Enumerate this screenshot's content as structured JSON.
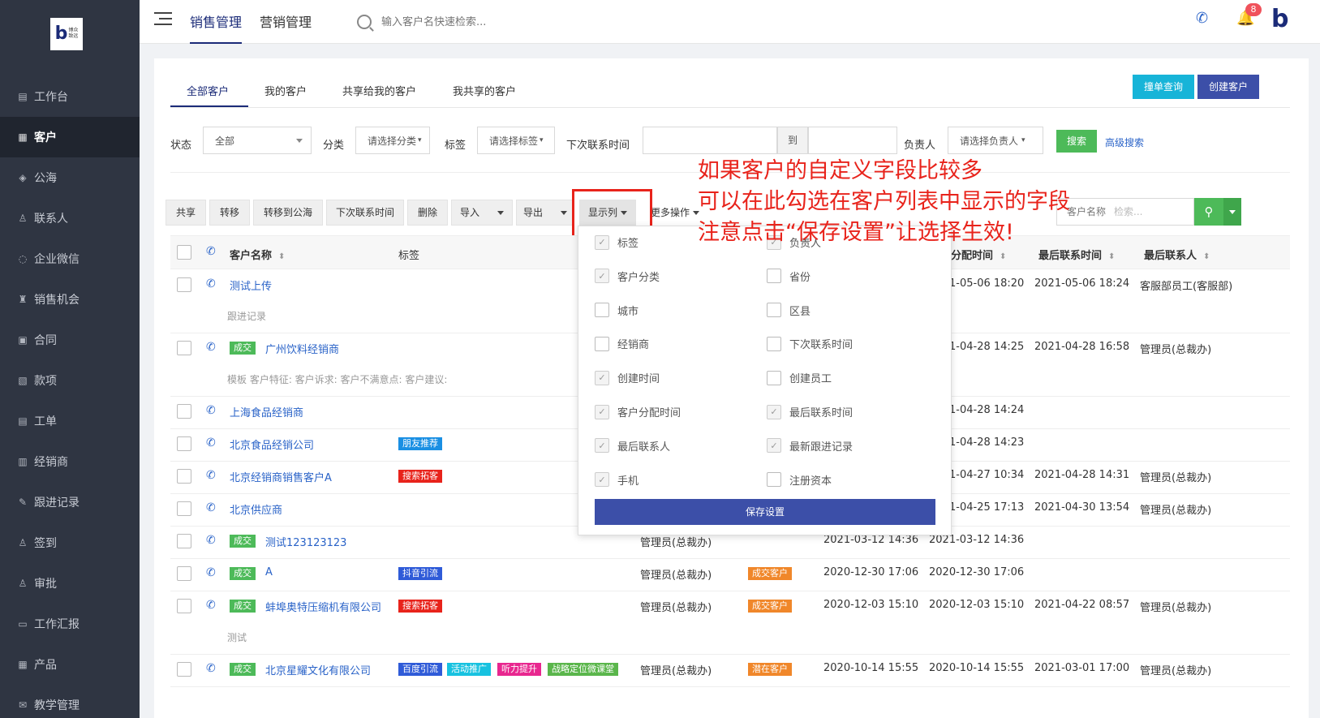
{
  "sidebar": {
    "logo": {
      "letter": "b",
      "text": "博众\n致远"
    },
    "items": [
      {
        "icon": "dashboard-icon",
        "glyph": "▤",
        "label": "工作台",
        "active": false
      },
      {
        "icon": "customer-icon",
        "glyph": "▦",
        "label": "客户",
        "active": true
      },
      {
        "icon": "public-pool-icon",
        "glyph": "◈",
        "label": "公海",
        "active": false
      },
      {
        "icon": "contact-icon",
        "glyph": "♙",
        "label": "联系人",
        "active": false
      },
      {
        "icon": "wechat-icon",
        "glyph": "◌",
        "label": "企业微信",
        "active": false
      },
      {
        "icon": "opportunity-icon",
        "glyph": "♜",
        "label": "销售机会",
        "active": false
      },
      {
        "icon": "contract-icon",
        "glyph": "▣",
        "label": "合同",
        "active": false
      },
      {
        "icon": "payment-icon",
        "glyph": "▧",
        "label": "款项",
        "active": false
      },
      {
        "icon": "ticket-icon",
        "glyph": "▤",
        "label": "工单",
        "active": false
      },
      {
        "icon": "dealer-icon",
        "glyph": "▥",
        "label": "经销商",
        "active": false
      },
      {
        "icon": "followup-icon",
        "glyph": "✎",
        "label": "跟进记录",
        "active": false
      },
      {
        "icon": "checkin-icon",
        "glyph": "♙",
        "label": "签到",
        "active": false
      },
      {
        "icon": "approval-icon",
        "glyph": "♙",
        "label": "审批",
        "active": false
      },
      {
        "icon": "report-icon",
        "glyph": "▭",
        "label": "工作汇报",
        "active": false
      },
      {
        "icon": "product-icon",
        "glyph": "▦",
        "label": "产品",
        "active": false
      },
      {
        "icon": "teaching-icon",
        "glyph": "✉",
        "label": "教学管理",
        "active": false
      }
    ]
  },
  "topbar": {
    "tabs": [
      {
        "label": "销售管理",
        "active": true
      },
      {
        "label": "营销管理",
        "active": false
      }
    ],
    "search_placeholder": "输入客户名快速检索...",
    "bell_count": "8",
    "brand_letter": "b"
  },
  "subtabs": [
    {
      "label": "全部客户",
      "active": true
    },
    {
      "label": "我的客户",
      "active": false
    },
    {
      "label": "共享给我的客户",
      "active": false
    },
    {
      "label": "我共享的客户",
      "active": false
    }
  ],
  "actions": {
    "check_duplicate": "撞单查询",
    "create_customer": "创建客户"
  },
  "filters": {
    "status_label": "状态",
    "status_value": "全部",
    "category_label": "分类",
    "category_value": "请选择分类",
    "tag_label": "标签",
    "tag_value": "请选择标签",
    "next_contact_label": "下次联系时间",
    "to_label": "到",
    "owner_label": "负责人",
    "owner_value": "请选择负责人",
    "search_btn": "搜索",
    "advanced": "高级搜索"
  },
  "toolbar": {
    "share": "共享",
    "transfer": "转移",
    "to_pool": "转移到公海",
    "next_contact": "下次联系时间",
    "delete": "删除",
    "import": "导入",
    "export": "导出",
    "columns": "显示列",
    "more": "更多操作",
    "search_field": "客户名称",
    "search_placeholder": "检索..."
  },
  "table_headers": {
    "name": "客户名称",
    "tags": "标签",
    "assign_time": "分配时间",
    "last_contact_time": "最后联系时间",
    "last_contact": "最后联系人"
  },
  "rows": [
    {
      "status": "",
      "name": "测试上传",
      "tags": [],
      "owner": "",
      "stage": "",
      "create": "",
      "assign": "1-05-06 18:20",
      "last_time": "2021-05-06 18:24",
      "last_person": "客服部员工(客服部)",
      "note": "跟进记录"
    },
    {
      "status": "成交",
      "name": "广州饮料经销商",
      "tags": [],
      "owner": "",
      "stage": "",
      "create": "",
      "assign": "1-04-28 14:25",
      "last_time": "2021-04-28 16:58",
      "last_person": "管理员(总裁办)",
      "note": "模板 客户特征:   客户诉求:   客户不满意点:   客户建议:"
    },
    {
      "status": "",
      "name": "上海食品经销商",
      "tags": [],
      "owner": "",
      "stage": "",
      "create": "",
      "assign": "1-04-28 14:24",
      "last_time": "",
      "last_person": "",
      "note": ""
    },
    {
      "status": "",
      "name": "北京食品经销公司",
      "tags": [
        {
          "label": "朋友推荐",
          "color": "t-blue"
        }
      ],
      "owner": "",
      "stage": "",
      "create": "",
      "assign": "1-04-28 14:23",
      "last_time": "",
      "last_person": "",
      "note": ""
    },
    {
      "status": "",
      "name": "北京经销商销售客户A",
      "tags": [
        {
          "label": "搜索拓客",
          "color": "t-red"
        }
      ],
      "owner": "",
      "stage": "",
      "create": "",
      "assign": "1-04-27 10:34",
      "last_time": "2021-04-28 14:31",
      "last_person": "管理员(总裁办)",
      "note": ""
    },
    {
      "status": "",
      "name": "北京供应商",
      "tags": [],
      "owner": "",
      "stage": "",
      "create": "",
      "assign": "1-04-25 17:13",
      "last_time": "2021-04-30 13:54",
      "last_person": "管理员(总裁办)",
      "note": ""
    },
    {
      "status": "成交",
      "name": "测试123123123",
      "tags": [],
      "owner": "管理员(总裁办)",
      "stage": "",
      "create": "2021-03-12 14:36",
      "assign": "2021-03-12 14:36",
      "last_time": "",
      "last_person": "",
      "note": ""
    },
    {
      "status": "成交",
      "name": "A",
      "tags": [
        {
          "label": "抖音引流",
          "color": "t-bdark"
        }
      ],
      "owner": "管理员(总裁办)",
      "stage": "成交客户",
      "create": "2020-12-30 17:06",
      "assign": "2020-12-30 17:06",
      "last_time": "",
      "last_person": "",
      "note": ""
    },
    {
      "status": "成交",
      "name": "蚌埠奥特压缩机有限公司",
      "tags": [
        {
          "label": "搜索拓客",
          "color": "t-red"
        }
      ],
      "owner": "管理员(总裁办)",
      "stage": "成交客户",
      "create": "2020-12-03 15:10",
      "assign": "2020-12-03 15:10",
      "last_time": "2021-04-22 08:57",
      "last_person": "管理员(总裁办)",
      "note": "测试"
    },
    {
      "status": "成交",
      "name": "北京星耀文化有限公司",
      "tags": [
        {
          "label": "百度引流",
          "color": "t-bdark"
        },
        {
          "label": "活动推广",
          "color": "t-cyan"
        },
        {
          "label": "听力提升",
          "color": "t-pink"
        },
        {
          "label": "战略定位微课堂",
          "color": "t-olive"
        }
      ],
      "owner": "管理员(总裁办)",
      "stage": "潜在客户",
      "create": "2020-10-14 15:55",
      "assign": "2020-10-14 15:55",
      "last_time": "2021-03-01 17:00",
      "last_person": "管理员(总裁办)",
      "note": ""
    }
  ],
  "column_popup": {
    "left": [
      {
        "label": "标签",
        "checked": true
      },
      {
        "label": "客户分类",
        "checked": true
      },
      {
        "label": "城市",
        "checked": false
      },
      {
        "label": "经销商",
        "checked": false
      },
      {
        "label": "创建时间",
        "checked": true
      },
      {
        "label": "客户分配时间",
        "checked": true
      },
      {
        "label": "最后联系人",
        "checked": true
      },
      {
        "label": "手机",
        "checked": true
      }
    ],
    "right": [
      {
        "label": "负责人",
        "checked": true
      },
      {
        "label": "省份",
        "checked": false
      },
      {
        "label": "区县",
        "checked": false
      },
      {
        "label": "下次联系时间",
        "checked": false
      },
      {
        "label": "创建员工",
        "checked": false
      },
      {
        "label": "最后联系时间",
        "checked": true
      },
      {
        "label": "最新跟进记录",
        "checked": true
      },
      {
        "label": "注册资本",
        "checked": false
      }
    ],
    "save": "保存设置"
  },
  "annotation": {
    "line1": "如果客户的自定义字段比较多",
    "line2": "可以在此勾选在客户列表中显示的字段",
    "line3": "注意点击“保存设置”让选择生效!"
  },
  "colors": {
    "brand": "#1b2b78",
    "accent_green": "#4dba59",
    "annotation_red": "#e8231b"
  }
}
